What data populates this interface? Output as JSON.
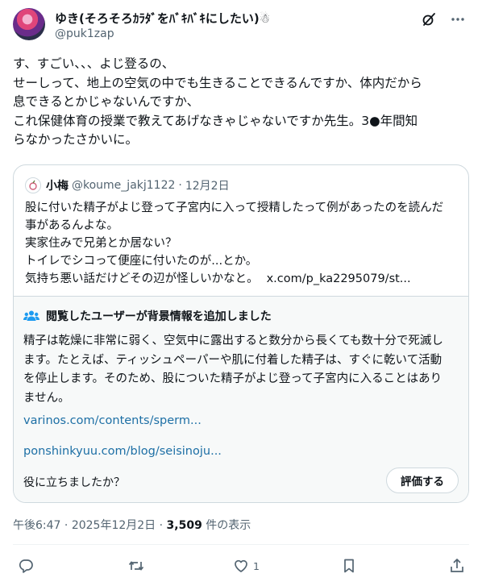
{
  "post": {
    "display_name": "ゆき(そろそろｶﾗﾀﾞをﾊﾞｷﾊﾞｷにしたい)",
    "display_name_emoji": "☃",
    "handle": "@puk1zap",
    "text_lines": [
      "す、すごい、、、よじ登るの、",
      "せーしって、地上の空気の中でも生きることできるんですか、体内だから",
      "息できるとかじゃないんですか、",
      "これ保健体育の授業で教えてあげなきゃじゃないですか先生。3●年間知",
      "らなかったさかいに。"
    ],
    "time": "午後6:47",
    "sep1": "·",
    "date": "2025年12月2日",
    "sep2": "·",
    "views": "3,509",
    "views_label": "件の表示",
    "like_count": "1"
  },
  "quote": {
    "name": "小梅",
    "handle": "@koume_jakj1122",
    "sep": "·",
    "date": "12月2日",
    "lines": [
      "股に付いた精子がよじ登って子宮内に入って授精したって例があったのを読んだ",
      "事があるんよな。",
      "実家住みで兄弟とか居ない？",
      "トイレでシコって便座に付いたのが...とか。",
      "気持ち悪い話だけどその辺が怪しいかなと。"
    ],
    "link": "x.com/p_ka2295079/st..."
  },
  "community_note": {
    "title": "閲覧したユーザーが背景情報を追加しました",
    "lines": [
      "精子は乾燥に非常に弱く、空気中に露出すると数分から長くても数十分で死滅し",
      "ます。たとえば、ティッシュペーパーや肌に付着した精子は、すぐに乾いて活動",
      "を停止します。そのため、股についた精子がよじ登って子宮内に入ることはあり",
      "ません。"
    ],
    "links": [
      "varinos.com/contents/sperm...",
      "ponshinkyuu.com/blog/seisinoju..."
    ],
    "helpful_question": "役に立ちましたか？",
    "rate_button": "評価する"
  },
  "icons": [
    "avatar",
    "grok-icon",
    "more-icon",
    "people-icon",
    "reply-icon",
    "repost-icon",
    "like-icon",
    "bookmark-icon",
    "share-icon"
  ],
  "colors": {
    "text": "#0f1419",
    "secondary": "#536471",
    "link": "#1d6fa5",
    "note_bg": "#f7f9f9",
    "border": "#cfd9de"
  }
}
